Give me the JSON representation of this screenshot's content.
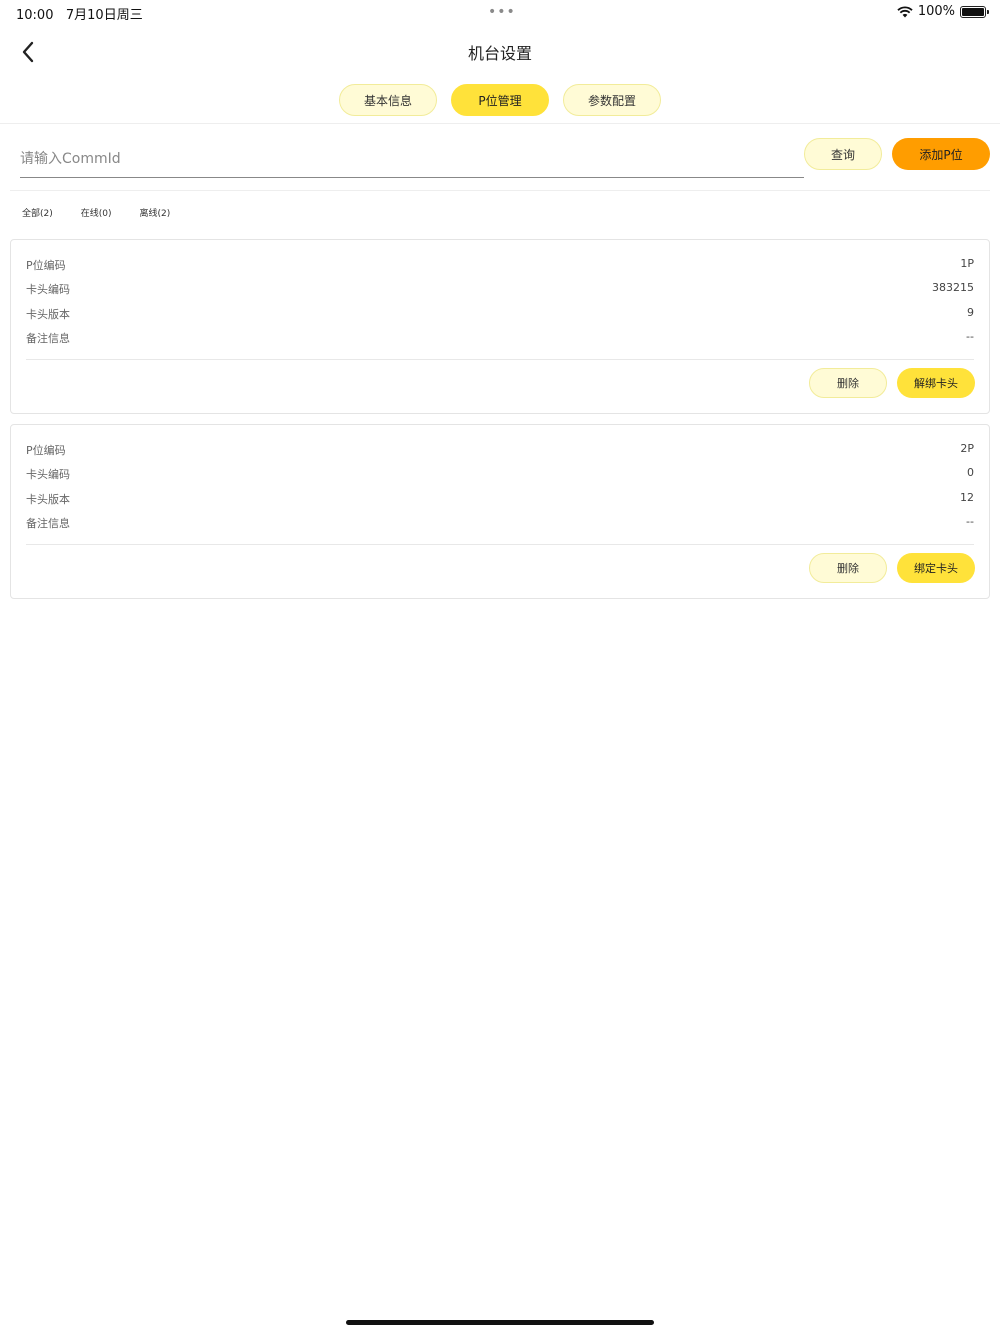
{
  "status_bar": {
    "time": "10:00",
    "date": "7月10日周三",
    "battery_pct": "100%"
  },
  "nav": {
    "title": "机台设置",
    "back_icon": "chevron-left-icon"
  },
  "tabs": [
    {
      "label": "基本信息",
      "active": false
    },
    {
      "label": "P位管理",
      "active": true
    },
    {
      "label": "参数配置",
      "active": false
    }
  ],
  "search": {
    "placeholder": "请输入CommId",
    "value": "",
    "query_label": "查询",
    "add_label": "添加P位"
  },
  "filters": [
    {
      "label": "全部(2)"
    },
    {
      "label": "在线(0)"
    },
    {
      "label": "离线(2)"
    }
  ],
  "cards": [
    {
      "rows": [
        {
          "label": "P位编码",
          "value": "1P"
        },
        {
          "label": "卡头编码",
          "value": "383215"
        },
        {
          "label": "卡头版本",
          "value": "9"
        },
        {
          "label": "备注信息",
          "value": "--"
        }
      ],
      "delete_label": "删除",
      "action_label": "解绑卡头"
    },
    {
      "rows": [
        {
          "label": "P位编码",
          "value": "2P"
        },
        {
          "label": "卡头编码",
          "value": "0"
        },
        {
          "label": "卡头版本",
          "value": "12"
        },
        {
          "label": "备注信息",
          "value": "--"
        }
      ],
      "delete_label": "删除",
      "action_label": "绑定卡头"
    }
  ],
  "colors": {
    "accent_yellow": "#ffe23a",
    "light_yellow": "#fffbd6",
    "orange": "#ff9d00"
  }
}
